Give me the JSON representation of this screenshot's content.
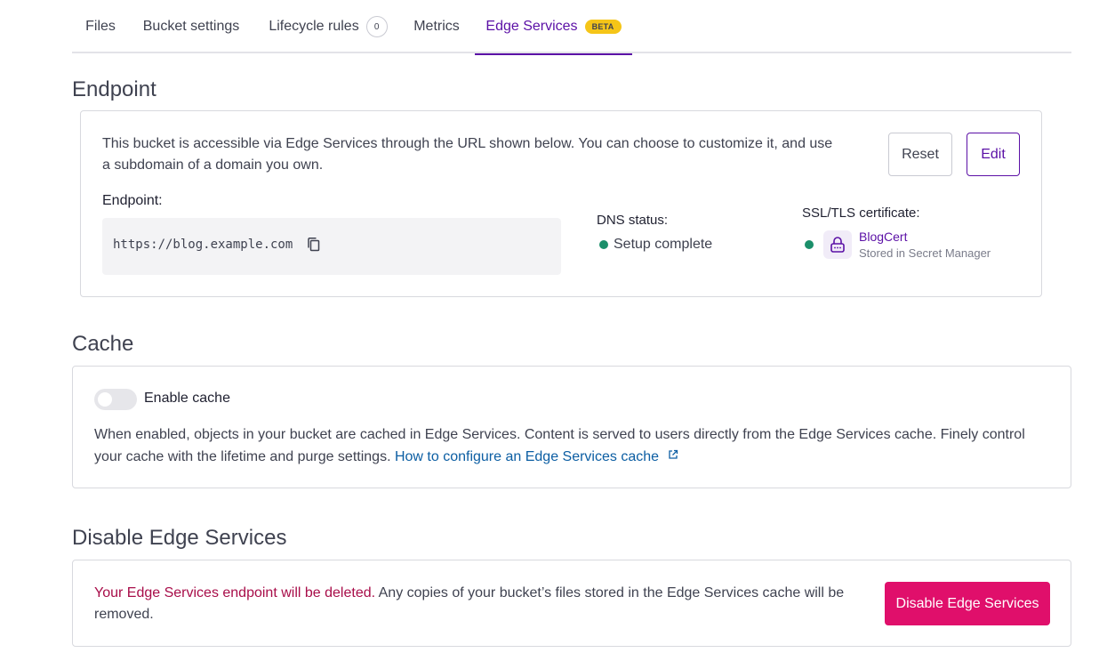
{
  "tabs": [
    {
      "label": "Files"
    },
    {
      "label": "Bucket settings"
    },
    {
      "label": "Lifecycle rules",
      "count": "0"
    },
    {
      "label": "Metrics"
    },
    {
      "label": "Edge Services",
      "badge": "BETA",
      "active": true
    }
  ],
  "endpoint_section": {
    "title": "Endpoint",
    "description": "This bucket is accessible via Edge Services through the URL shown below. You can choose to customize it, and use a subdomain of a domain you own.",
    "reset_label": "Reset",
    "edit_label": "Edit",
    "endpoint_label": "Endpoint:",
    "endpoint_url": "https://blog.example.com",
    "dns_label": "DNS status:",
    "dns_value": "Setup complete",
    "ssl_label": "SSL/TLS certificate:",
    "cert_name": "BlogCert",
    "cert_store": "Stored in Secret Manager"
  },
  "cache_section": {
    "title": "Cache",
    "toggle_label": "Enable cache",
    "toggle_on": false,
    "description": "When enabled, objects in your bucket are cached in Edge Services. Content is served to users directly from the Edge Services cache. Finely control your cache with the lifetime and purge settings.",
    "link_text": "How to configure an Edge Services cache"
  },
  "disable_section": {
    "title": "Disable Edge Services",
    "warning_strong": "Your Edge Services endpoint will be deleted.",
    "warning_rest": "Any copies of your bucket’s files stored in the Edge Services cache will be removed.",
    "button_label": "Disable Edge Services"
  },
  "colors": {
    "accent": "#5b10a6",
    "success": "#1b8f6a",
    "danger": "#e00f6b",
    "danger_text": "#a80d49",
    "link": "#0c5ea3",
    "beta_badge": "#f5c518"
  },
  "icons": {
    "copy": "copy-icon",
    "lock": "lock-icon",
    "external": "external-link-icon"
  }
}
